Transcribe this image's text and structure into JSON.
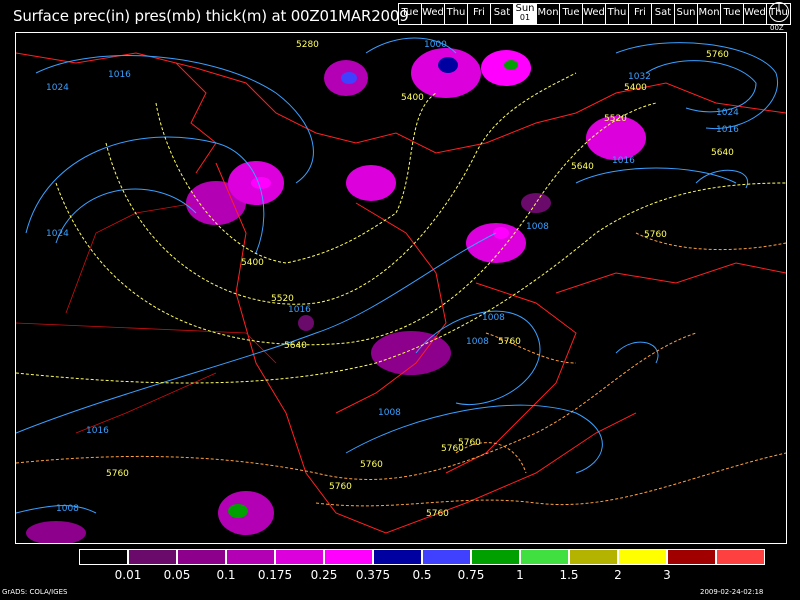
{
  "title": "Surface prec(in) pres(mb) thick(m) at 00Z01MAR2009",
  "days": [
    {
      "top": "Tue",
      "bottom": ""
    },
    {
      "top": "Wed",
      "bottom": ""
    },
    {
      "top": "Thu",
      "bottom": ""
    },
    {
      "top": "Fri",
      "bottom": ""
    },
    {
      "top": "Sat",
      "bottom": ""
    },
    {
      "top": "Sun",
      "bottom": "01"
    },
    {
      "top": "Mon",
      "bottom": ""
    },
    {
      "top": "Tue",
      "bottom": ""
    },
    {
      "top": "Wed",
      "bottom": ""
    },
    {
      "top": "Thu",
      "bottom": ""
    },
    {
      "top": "Fri",
      "bottom": ""
    },
    {
      "top": "Sat",
      "bottom": ""
    },
    {
      "top": "Sun",
      "bottom": ""
    },
    {
      "top": "Mon",
      "bottom": ""
    },
    {
      "top": "Tue",
      "bottom": ""
    },
    {
      "top": "Wed",
      "bottom": ""
    },
    {
      "top": "Thu",
      "bottom": ""
    }
  ],
  "selected_day_index": 5,
  "clock_label": "00Z",
  "legend": {
    "colors": [
      "#000000",
      "#6a0a6a",
      "#8c008c",
      "#b400b4",
      "#dc00dc",
      "#ff00ff",
      "#0000a0",
      "#4040ff",
      "#00a000",
      "#40e040",
      "#b4b400",
      "#ffff00",
      "#a00000",
      "#ff4040"
    ],
    "labels": [
      "0.01",
      "0.05",
      "0.1",
      "0.175",
      "0.25",
      "0.375",
      "0.5",
      "0.75",
      "1",
      "1.5",
      "2",
      "3"
    ]
  },
  "contour_labels": {
    "pressure": [
      "1024",
      "1016",
      "1000",
      "1032",
      "1024",
      "1016",
      "1016",
      "1024",
      "1008",
      "1016",
      "1008",
      "1008",
      "1008",
      "1016",
      "1008"
    ],
    "thickness": [
      "5280",
      "5400",
      "5400",
      "5520",
      "5400",
      "5640",
      "5640",
      "5760",
      "5520",
      "5640",
      "5760",
      "5760",
      "5760",
      "5760",
      "5760",
      "5760",
      "5760",
      "5760"
    ]
  },
  "colors": {
    "pressure": "#3aa0ff",
    "thickness_cold": "#ffff60",
    "thickness_warm": "#ffa040",
    "coast": "#ff2020"
  },
  "footer": {
    "left": "GrADS: COLA/IGES",
    "right": "2009-02-24-02:18"
  }
}
